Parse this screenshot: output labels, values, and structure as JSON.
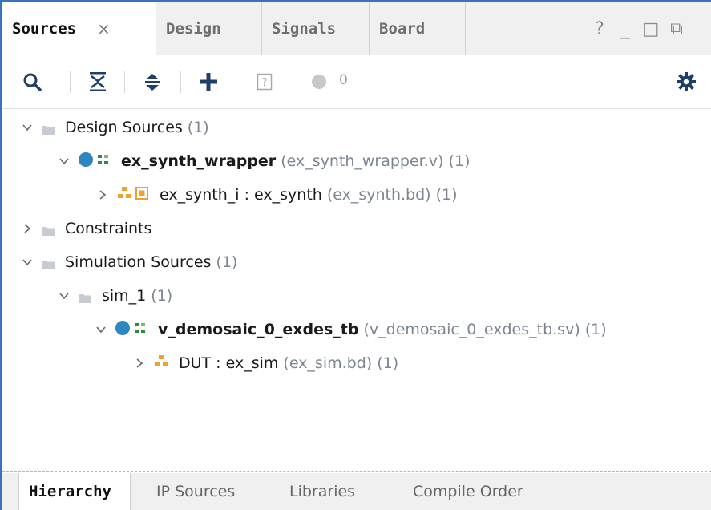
{
  "tabs": [
    {
      "label": "Sources",
      "active": true,
      "closable": true
    },
    {
      "label": "Design",
      "active": false
    },
    {
      "label": "Signals",
      "active": false
    },
    {
      "label": "Board",
      "active": false
    }
  ],
  "window_controls": [
    "?",
    "_",
    "□",
    "⧉"
  ],
  "toolbar": {
    "issues_count": "0",
    "icons": [
      "search-icon",
      "collapse-all-icon",
      "expand-all-icon",
      "add-icon",
      "unknown-file-icon",
      "issues-indicator-icon",
      "gear-icon"
    ]
  },
  "tree": [
    {
      "name": "Design Sources",
      "count": "(1)"
    },
    {
      "name": "ex_synth_wrapper",
      "file": "(ex_synth_wrapper.v)",
      "count": "(1)"
    },
    {
      "name": "ex_synth_i : ex_synth",
      "file": "(ex_synth.bd)",
      "count": "(1)"
    },
    {
      "name": "Constraints"
    },
    {
      "name": "Simulation Sources",
      "count": "(1)"
    },
    {
      "name": "sim_1",
      "count": "(1)"
    },
    {
      "name": "v_demosaic_0_exdes_tb",
      "file": "(v_demosaic_0_exdes_tb.sv)",
      "count": "(1)"
    },
    {
      "name": "DUT : ex_sim",
      "file": "(ex_sim.bd)",
      "count": "(1)"
    }
  ],
  "bottom_tabs": [
    {
      "label": "Hierarchy",
      "active": true
    },
    {
      "label": "IP Sources",
      "active": false
    },
    {
      "label": "Libraries",
      "active": false
    },
    {
      "label": "Compile Order",
      "active": false
    }
  ],
  "colors": {
    "accent": "#3b73b9",
    "top_module": "#2e86c1",
    "block_design": "#f0a030"
  }
}
